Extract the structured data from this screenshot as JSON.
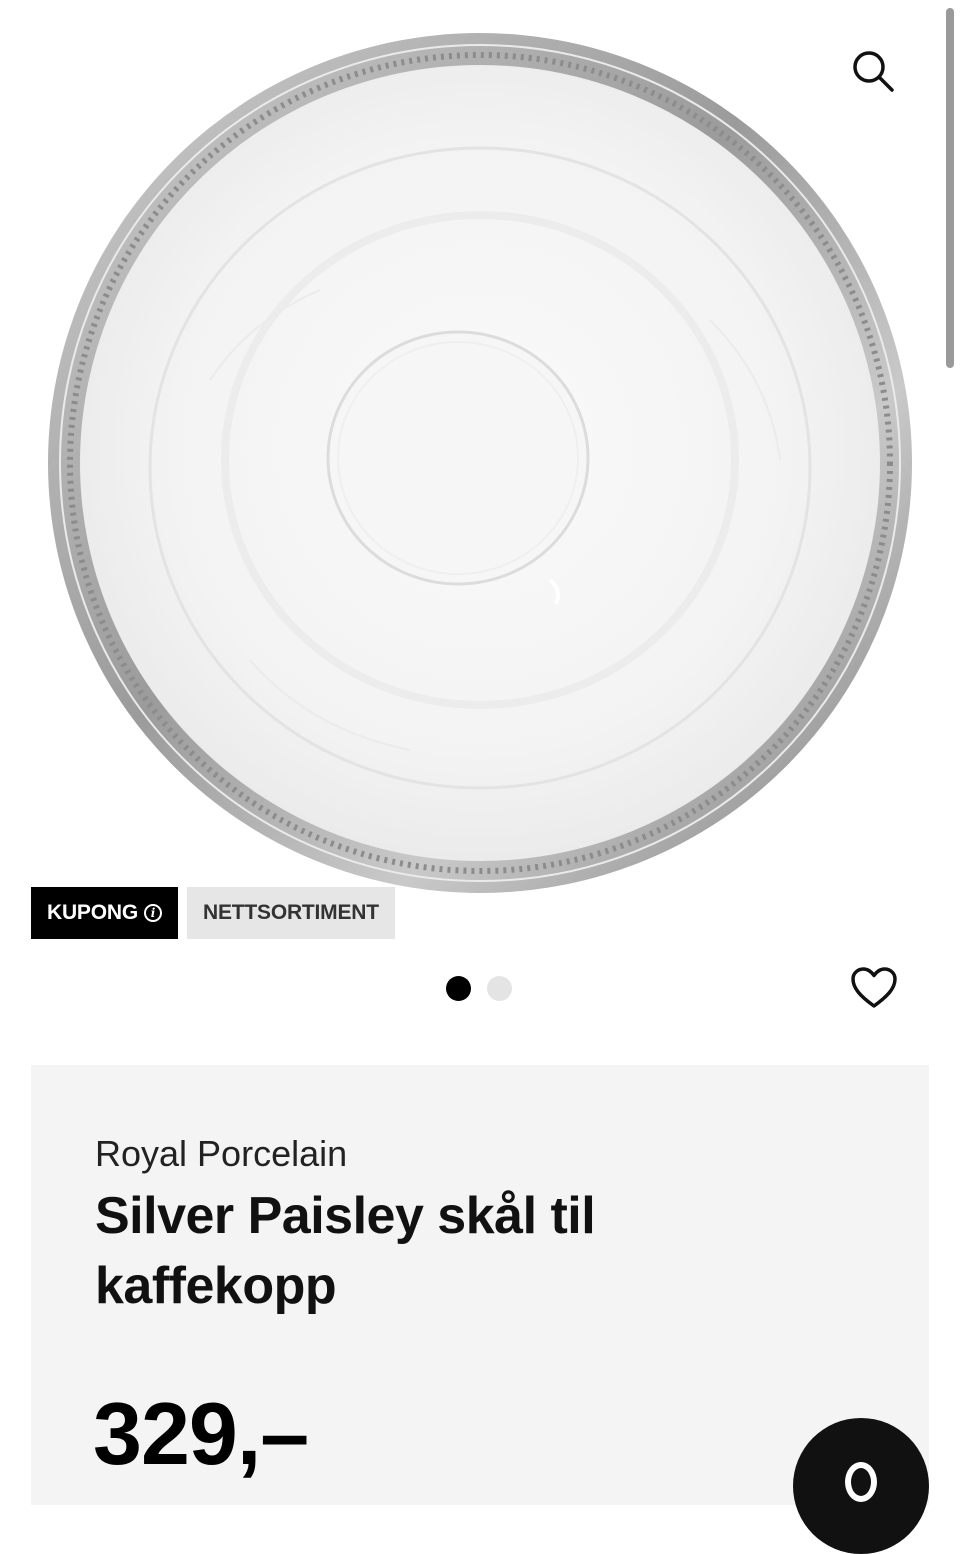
{
  "gallery": {
    "image_label": "Silver Paisley saucer product photo",
    "current_slide": 1,
    "total_slides": 2
  },
  "icons": {
    "search": "search-icon",
    "info": "info-icon",
    "favorite": "heart-icon"
  },
  "badges": {
    "coupon_label": "KUPONG",
    "web_label": "NETTSORTIMENT"
  },
  "product": {
    "brand": "Royal Porcelain",
    "title": "Silver Paisley skål til kaffekopp",
    "price": "329,–"
  },
  "colors": {
    "coupon_bg": "#000000",
    "web_badge_bg": "#e6e6e6",
    "card_bg": "#f4f4f4",
    "dot_active": "#000000",
    "dot_inactive": "#e4e4e4"
  }
}
